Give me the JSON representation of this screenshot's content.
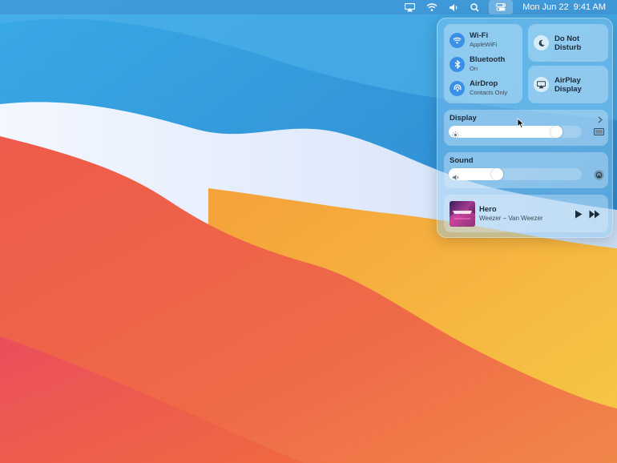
{
  "menubar": {
    "icons": [
      "airplay-icon",
      "wifi-icon",
      "volume-icon",
      "search-icon",
      "control-center-icon"
    ],
    "date": "Mon Jun 22",
    "time": "9:41 AM"
  },
  "control_center": {
    "wifi": {
      "title": "Wi-Fi",
      "subtitle": "AppleWiFi",
      "icon": "wifi-icon"
    },
    "bluetooth": {
      "title": "Bluetooth",
      "subtitle": "On",
      "icon": "bluetooth-icon"
    },
    "airdrop": {
      "title": "AirDrop",
      "subtitle": "Contacts Only",
      "icon": "airdrop-icon"
    },
    "dnd": {
      "title": "Do Not Disturb",
      "icon": "moon-icon"
    },
    "airplay": {
      "title": "AirPlay Display",
      "icon": "airplay-display-icon"
    },
    "display": {
      "title": "Display",
      "brightness": 0.84
    },
    "sound": {
      "title": "Sound",
      "volume": 0.35
    },
    "now_playing": {
      "title": "Hero",
      "artist": "Weezer – Van Weezer"
    }
  },
  "colors": {
    "accent": "#3a8fe6",
    "panel": "#8cc8f0"
  }
}
